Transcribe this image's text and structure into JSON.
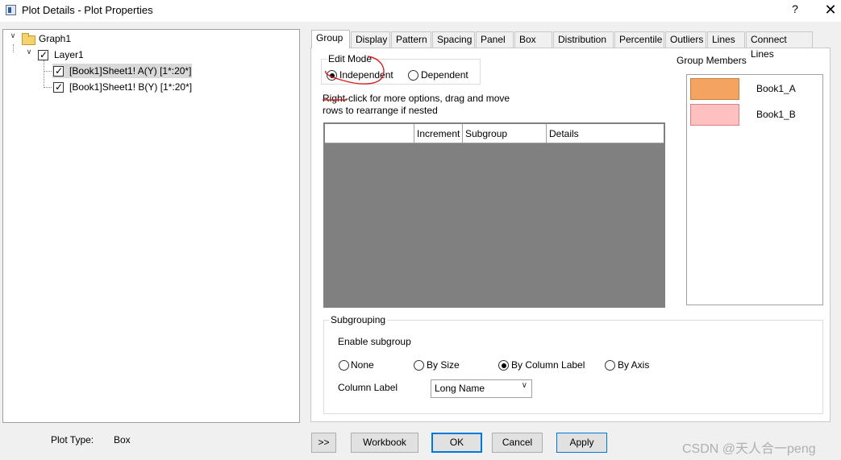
{
  "window": {
    "title": "Plot Details - Plot Properties",
    "help_label": "?",
    "close_label": "✕"
  },
  "tree": {
    "root": "Graph1",
    "layer": "Layer1",
    "items": [
      {
        "label": "[Book1]Sheet1! A(Y) [1*:20*]",
        "checked": true,
        "selected": true
      },
      {
        "label": "[Book1]Sheet1! B(Y) [1*:20*]",
        "checked": true,
        "selected": false
      }
    ]
  },
  "tabs": [
    {
      "label": "Group",
      "active": true
    },
    {
      "label": "Display"
    },
    {
      "label": "Pattern"
    },
    {
      "label": "Spacing"
    },
    {
      "label": "Panel"
    },
    {
      "label": "Box"
    },
    {
      "label": "Distribution"
    },
    {
      "label": "Percentile"
    },
    {
      "label": "Outliers"
    },
    {
      "label": "Lines"
    },
    {
      "label": "Connect Lines"
    }
  ],
  "group_tab": {
    "edit_mode": {
      "label": "Edit Mode",
      "options": [
        "Independent",
        "Dependent"
      ],
      "selected": "Independent"
    },
    "hint_line1": "Right-click for more options, drag and move",
    "hint_line2": "rows to  rearrange if nested",
    "table_columns": [
      "",
      "Increment",
      "Subgroup",
      "Details"
    ],
    "members_label": "Group Members",
    "members": [
      {
        "name": "Book1_A",
        "color": "#f4a460"
      },
      {
        "name": "Book1_B",
        "color": "#ffc0c0"
      }
    ],
    "subgrouping": {
      "label": "Subgrouping",
      "enable_label": "Enable subgroup",
      "options": [
        "None",
        "By Size",
        "By Column Label",
        "By Axis"
      ],
      "selected": "By Column Label",
      "column_label_label": "Column Label",
      "column_label_value": "Long Name"
    }
  },
  "footer": {
    "plot_type_label": "Plot Type:",
    "plot_type_value": "Box",
    "buttons": [
      ">>",
      "Workbook",
      "OK",
      "Cancel",
      "Apply"
    ]
  },
  "watermark": "CSDN @天人合一peng",
  "colors": {
    "annotation": "#d62020",
    "table_fill": "#808080",
    "focus": "#0078d7"
  }
}
